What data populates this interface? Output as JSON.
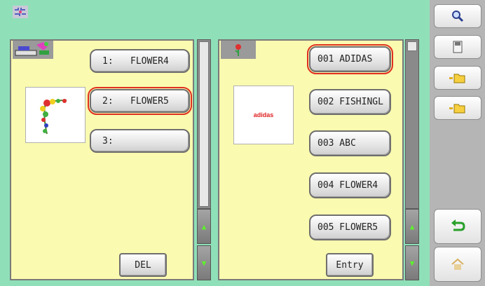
{
  "memory_list": [
    {
      "num": "1:",
      "name": "FLOWER4",
      "selected": false
    },
    {
      "num": "2:",
      "name": "FLOWER5",
      "selected": true
    },
    {
      "num": "3:",
      "name": "",
      "selected": false
    }
  ],
  "pattern_list": [
    {
      "name": "001 ADIDAS",
      "selected": true
    },
    {
      "name": "002 FISHINGL",
      "selected": false
    },
    {
      "name": "003 ABC",
      "selected": false
    },
    {
      "name": "004 FLOWER4",
      "selected": false
    },
    {
      "name": "005 FLOWER5",
      "selected": false
    }
  ],
  "buttons": {
    "del": "DEL",
    "entry": "Entry"
  },
  "preview": {
    "pattern_thumb_text": "adidas"
  },
  "colors": {
    "background": "#8fe0b8",
    "panel": "#fafab0",
    "selection_outline": "#e03020",
    "scroll_arrow": "#5ef02c"
  },
  "icons": {
    "top_left": "stitch-pattern-icon",
    "memory_header": "machine-icon",
    "pattern_header": "flower-icon",
    "sidebar": [
      "magnifier-icon",
      "floppy-disk-icon",
      "folder-in-icon",
      "folder-out-icon",
      "return-arrow-icon",
      "home-icon"
    ]
  }
}
